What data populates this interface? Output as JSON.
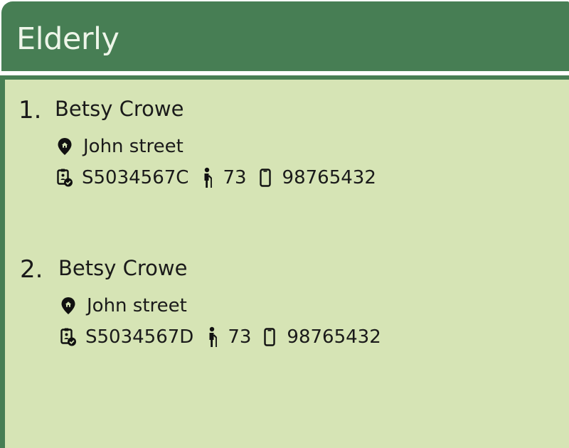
{
  "header": {
    "title": "Elderly"
  },
  "icons": {
    "address": "home-location-pin-icon",
    "nric": "id-badge-check-icon",
    "age": "elderly-person-cane-icon",
    "phone": "mobile-phone-icon"
  },
  "colors": {
    "header_bg": "#477e54",
    "header_text": "#eef5e9",
    "list_bg": "#d6e4b5",
    "text": "#1a1a1a"
  },
  "elderly": [
    {
      "index": "1.",
      "name": "Betsy Crowe",
      "address": "John street",
      "nric": "S5034567C",
      "age": "73",
      "phone": "98765432"
    },
    {
      "index": "2.",
      "name": "Betsy Crowe",
      "address": "John street",
      "nric": "S5034567D",
      "age": "73",
      "phone": "98765432"
    }
  ]
}
